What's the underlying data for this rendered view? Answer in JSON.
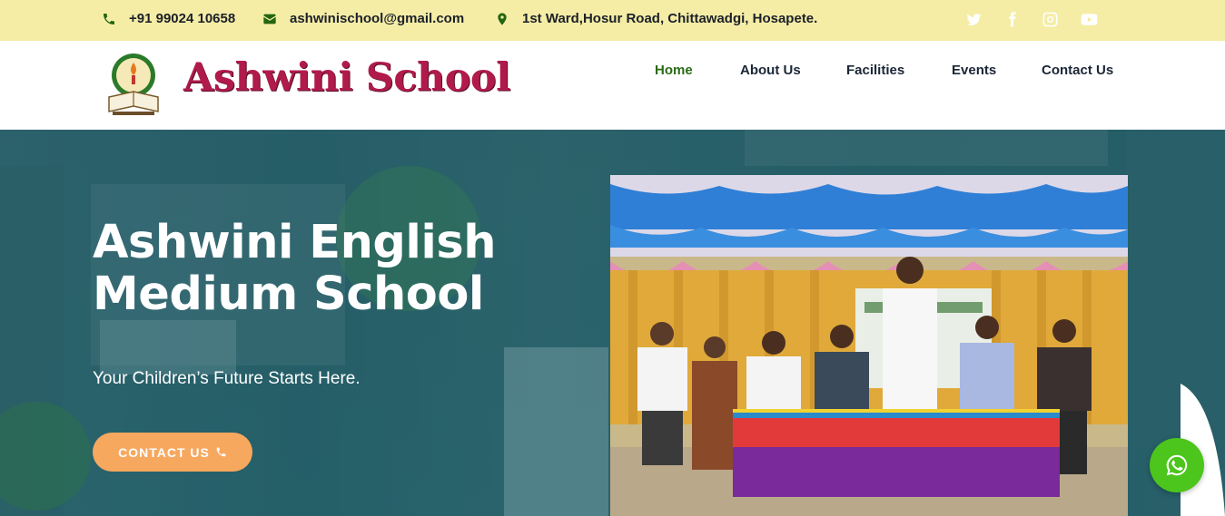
{
  "topbar": {
    "phone": "+91 99024 10658",
    "email": "ashwinischool@gmail.com",
    "address": "1st Ward,Hosur Road, Chittawadgi, Hosapete.",
    "icons": {
      "phone": "phone-icon",
      "email": "envelope-icon",
      "address": "map-marker-icon"
    },
    "social": [
      "twitter-icon",
      "facebook-icon",
      "instagram-icon",
      "youtube-icon"
    ],
    "background": "#f5eda6",
    "icon_color": "#24650f"
  },
  "header": {
    "logo_text": "Ashwini School",
    "logo_color": "#b01b4b",
    "nav": [
      {
        "label": "Home",
        "active": true
      },
      {
        "label": "About Us",
        "active": false
      },
      {
        "label": "Facilities",
        "active": false
      },
      {
        "label": "Events",
        "active": false
      },
      {
        "label": "Contact Us",
        "active": false
      }
    ],
    "active_color": "#2a6b16"
  },
  "hero": {
    "title": "Ashwini English Medium School",
    "tagline": "Your Children’s Future Starts Here.",
    "cta_label": "CONTACT US",
    "cta_color": "#f7a85f",
    "overlay_color": "#2a6670"
  },
  "whatsapp": {
    "icon": "whatsapp-icon",
    "color": "#4cc51c"
  }
}
